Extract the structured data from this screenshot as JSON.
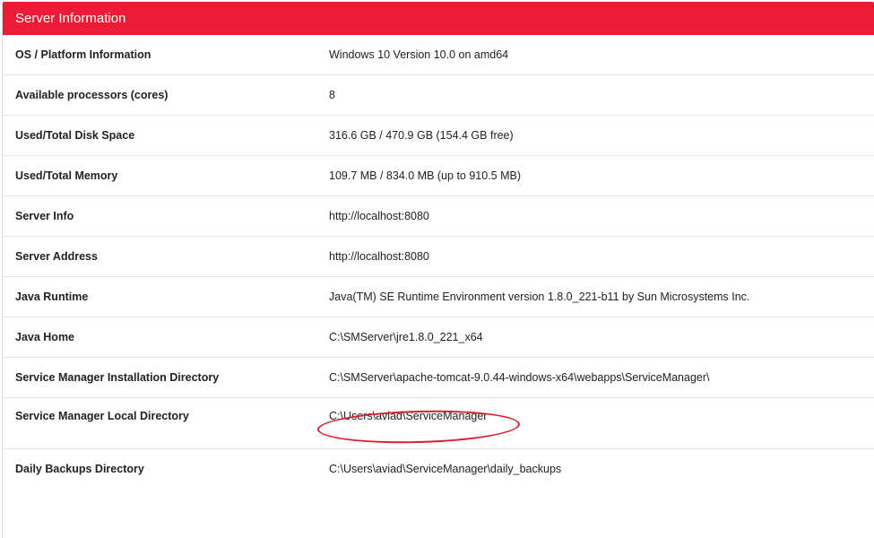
{
  "panel": {
    "title": "Server Information"
  },
  "rows": [
    {
      "label": "OS / Platform Information",
      "value": "Windows 10 Version 10.0 on amd64"
    },
    {
      "label": "Available processors (cores)",
      "value": "8"
    },
    {
      "label": "Used/Total Disk Space",
      "value": "316.6 GB  /  470.9 GB  (154.4 GB free)"
    },
    {
      "label": "Used/Total Memory",
      "value": "109.7 MB  /  834.0 MB  (up to 910.5 MB)"
    },
    {
      "label": "Server Info",
      "value": "http://localhost:8080"
    },
    {
      "label": "Server Address",
      "value": "http://localhost:8080"
    },
    {
      "label": "Java Runtime",
      "value": "Java(TM) SE Runtime Environment version 1.8.0_221-b11 by Sun Microsystems Inc."
    },
    {
      "label": "Java Home",
      "value": "C:\\SMServer\\jre1.8.0_221_x64"
    },
    {
      "label": "Service Manager Installation Directory",
      "value": "C:\\SMServer\\apache-tomcat-9.0.44-windows-x64\\webapps\\ServiceManager\\"
    },
    {
      "label": "Service Manager Local Directory",
      "value": "C:\\Users\\aviad\\ServiceManager"
    },
    {
      "label": "Daily Backups Directory",
      "value": "C:\\Users\\aviad\\ServiceManager\\daily_backups"
    }
  ],
  "colors": {
    "header": "#ee1b36",
    "annotation": "#d8202f"
  }
}
